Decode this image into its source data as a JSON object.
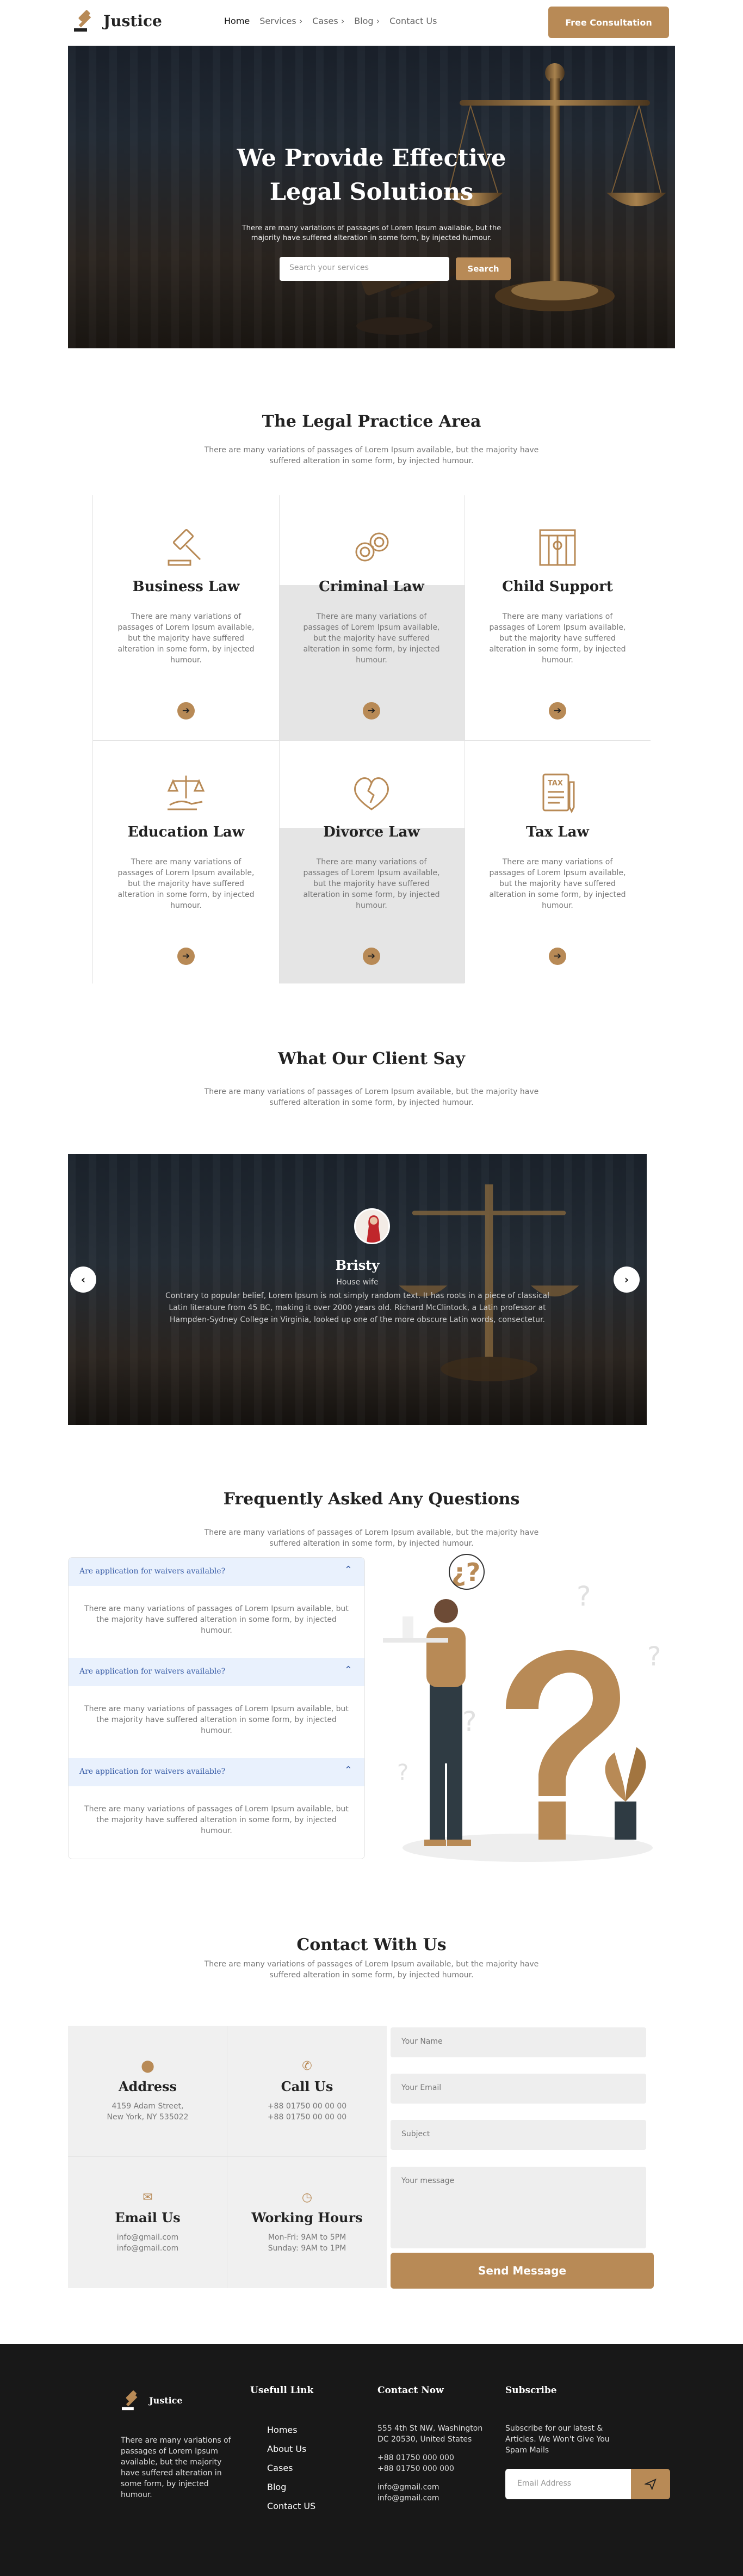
{
  "header": {
    "logo_text": "Justice",
    "nav": [
      {
        "label": "Home",
        "active": true,
        "has_dropdown": false
      },
      {
        "label": "Services",
        "active": false,
        "has_dropdown": true
      },
      {
        "label": "Cases",
        "active": false,
        "has_dropdown": true
      },
      {
        "label": "Blog",
        "active": false,
        "has_dropdown": true
      },
      {
        "label": "Contact Us",
        "active": false,
        "has_dropdown": false
      }
    ],
    "cta_label": "Free Consultation"
  },
  "hero": {
    "title_line1": "We Provide Effective",
    "title_line2": "Legal Solutions",
    "subtitle": "There are many variations of passages of Lorem Ipsum available, but the majority have suffered alteration in some form, by injected humour.",
    "search_placeholder": "Search your services",
    "search_button": "Search"
  },
  "practice": {
    "title": "The Legal Practice Area",
    "subtitle": "There are many variations of passages of Lorem Ipsum available, but the majority have suffered alteration in some form, by injected humour.",
    "cards": [
      {
        "title": "Business Law",
        "icon": "gavel-icon",
        "text": "There are many variations of passages of Lorem Ipsum available, but the majority have suffered alteration in some form, by injected humour.",
        "highlighted": false
      },
      {
        "title": "Criminal Law",
        "icon": "handcuffs-icon",
        "text": "There are many variations of passages of Lorem Ipsum available, but the majority have suffered alteration in some form, by injected humour.",
        "highlighted": true
      },
      {
        "title": "Child Support",
        "icon": "jail-icon",
        "text": "There are many variations of passages of Lorem Ipsum available, but the majority have suffered alteration in some form, by injected humour.",
        "highlighted": false
      },
      {
        "title": "Education Law",
        "icon": "scales-hand-icon",
        "text": "There are many variations of passages of Lorem Ipsum available, but the majority have suffered alteration in some form, by injected humour.",
        "highlighted": false
      },
      {
        "title": "Divorce Law",
        "icon": "broken-heart-icon",
        "text": "There are many variations of passages of Lorem Ipsum available, but the majority have suffered alteration in some form, by injected humour.",
        "highlighted": true
      },
      {
        "title": "Tax Law",
        "icon": "tax-document-icon",
        "text": "There are many variations of passages of Lorem Ipsum available, but the majority have suffered alteration in some form, by injected humour.",
        "highlighted": false
      }
    ],
    "tax_badge": "TAX"
  },
  "testimonials": {
    "title": "What Our Client Say",
    "subtitle": "There are many variations of passages of Lorem Ipsum available, but the majority have suffered alteration in some form, by injected humour.",
    "name": "Bristy",
    "role": "House wife",
    "text": "Contrary to popular belief, Lorem Ipsum is not simply random text. It has roots in a piece of classical Latin literature from 45 BC, making it over 2000 years old. Richard McClintock, a Latin professor at Hampden-Sydney College in Virginia, looked up one of the more obscure Latin words, consectetur."
  },
  "faq": {
    "title": "Frequently Asked Any Questions",
    "subtitle": "There are many variations of passages of Lorem Ipsum available, but the majority have suffered alteration in some form, by injected humour.",
    "items": [
      {
        "question": "Are application for waivers available?",
        "answer": "There are many variations of passages of Lorem Ipsum available, but the majority have suffered alteration in some form, by injected humour."
      },
      {
        "question": "Are application for waivers available?",
        "answer": "There are many variations of passages of Lorem Ipsum available, but the majority have suffered alteration in some form, by injected humour."
      },
      {
        "question": "Are application for waivers available?",
        "answer": "There are many variations of passages of Lorem Ipsum available, but the majority have suffered alteration in some form, by injected humour."
      }
    ]
  },
  "contact": {
    "title": "Contact With Us",
    "subtitle": "There are many variations of passages of Lorem Ipsum available, but the majority have suffered alteration in some form, by injected humour.",
    "address": {
      "title": "Address",
      "line1": "4159 Adam Street,",
      "line2": "New York, NY 535022"
    },
    "call": {
      "title": "Call Us",
      "line1": "+88 01750 00 00 00",
      "line2": "+88 01750 00 00 00"
    },
    "email": {
      "title": "Email Us",
      "line1": "info@gmail.com",
      "line2": "info@gmail.com"
    },
    "hours": {
      "title": "Working Hours",
      "line1": "Mon-Fri: 9AM to 5PM",
      "line2": "Sunday: 9AM to 1PM"
    },
    "form": {
      "name_placeholder": "Your Name",
      "email_placeholder": "Your Email",
      "subject_placeholder": "Subject",
      "message_placeholder": "Your message",
      "submit": "Send Message"
    }
  },
  "footer": {
    "logo_text": "Justice",
    "about": "There are many variations of passages of Lorem Ipsum available, but the majority have suffered alteration in some form, by injected humour.",
    "links_title": "Usefull Link",
    "links": [
      "Homes",
      "About Us",
      "Cases",
      "Blog",
      "Contact US"
    ],
    "contact_title": "Contact Now",
    "contact_address": "555 4th St NW, Washington DC 20530, United States",
    "contact_phone1": "+88 01750 000 000",
    "contact_phone2": "+88 01750 000 000",
    "contact_email1": "info@gmail.com",
    "contact_email2": "info@gmail.com",
    "subscribe_title": "Subscribe",
    "subscribe_text": "Subscribe for our latest & Articles. We Won't Give You Spam Mails",
    "email_placeholder": "Email Address"
  },
  "colors": {
    "accent": "#b88a56",
    "dark": "#181818",
    "faq_bg": "#e9f1fd",
    "highlight_card": "#e5e5e5"
  }
}
